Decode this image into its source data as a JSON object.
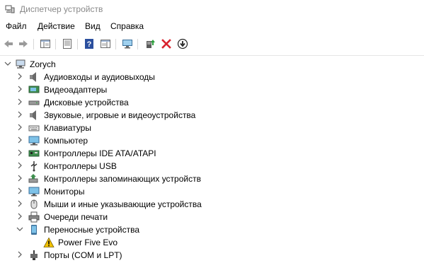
{
  "window": {
    "title": "Диспетчер устройств"
  },
  "menu": [
    "Файл",
    "Действие",
    "Вид",
    "Справка"
  ],
  "toolbar": {
    "buttons": [
      "back-icon",
      "forward-icon",
      "show-hide-console-tree-icon",
      "properties-icon",
      "help-icon",
      "action-pane-icon",
      "scan-hardware-icon",
      "update-driver-icon",
      "uninstall-icon",
      "disable-device-icon"
    ]
  },
  "tree": {
    "root": "Zorych",
    "items": [
      {
        "label": "Аудиовходы и аудиовыходы",
        "icon": "speaker-icon",
        "expanded": false
      },
      {
        "label": "Видеоадаптеры",
        "icon": "display-adapter-icon",
        "expanded": false
      },
      {
        "label": "Дисковые устройства",
        "icon": "disk-drive-icon",
        "expanded": false
      },
      {
        "label": "Звуковые, игровые и видеоустройства",
        "icon": "speaker-icon",
        "expanded": false
      },
      {
        "label": "Клавиатуры",
        "icon": "keyboard-icon",
        "expanded": false
      },
      {
        "label": "Компьютер",
        "icon": "computer-icon",
        "expanded": false
      },
      {
        "label": "Контроллеры IDE ATA/ATAPI",
        "icon": "controller-icon",
        "expanded": false
      },
      {
        "label": "Контроллеры USB",
        "icon": "usb-icon",
        "expanded": false
      },
      {
        "label": "Контроллеры запоминающих устройств",
        "icon": "storage-controller-icon",
        "expanded": false
      },
      {
        "label": "Мониторы",
        "icon": "monitor-icon",
        "expanded": false
      },
      {
        "label": "Мыши и иные указывающие устройства",
        "icon": "mouse-icon",
        "expanded": false
      },
      {
        "label": "Очереди печати",
        "icon": "printer-icon",
        "expanded": false
      },
      {
        "label": "Переносные устройства",
        "icon": "portable-device-icon",
        "expanded": true
      },
      {
        "label": "Power Five Evo",
        "icon": "warning-icon",
        "child": true
      },
      {
        "label": "Порты (COM и LPT)",
        "icon": "port-icon",
        "expanded": false
      }
    ]
  },
  "colors": {
    "title_text": "#8a8a8a",
    "warning": "#f2c200",
    "uninstall": "#d9232e",
    "help": "#2b4f9e",
    "update": "#2a9d3a"
  }
}
